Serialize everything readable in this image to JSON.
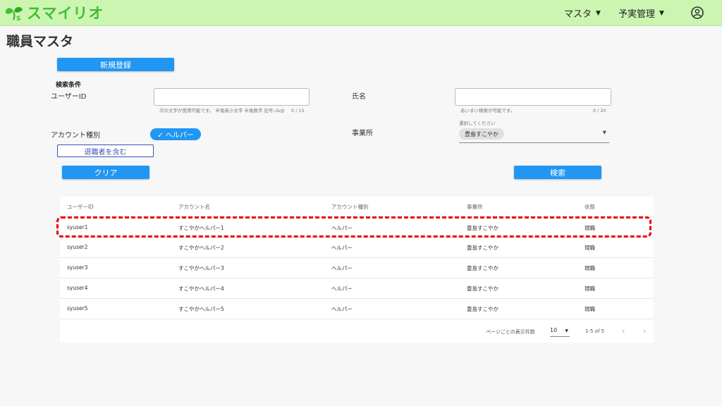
{
  "header": {
    "app_name": "スマイリオ",
    "menu_master": "マスタ",
    "menu_budget": "予実管理",
    "brand_color": "#ccf5b2",
    "account_icon": "account-circle-icon"
  },
  "page": {
    "title": "職員マスタ"
  },
  "actions": {
    "register_label": "新規登録",
    "clear_label": "クリア",
    "search_label": "検索"
  },
  "search": {
    "section_title": "検索条件",
    "user_id_label": "ユーザーID",
    "user_id_value": "",
    "user_id_hint": "次の文字が使用可能です。 半角英小文字 半角数字 記号-/&@",
    "user_id_counter": "0 / 15",
    "name_label": "氏名",
    "name_value": "",
    "name_hint": "あいまい検索が可能です。",
    "name_counter": "0 / 20",
    "account_type_label": "アカウント種別",
    "account_type_chip": "✓ ヘルパー",
    "office_label": "事業所",
    "office_placeholder": "選択してください",
    "office_selected": "豊島すこやか",
    "include_retired_label": "退職者を含む"
  },
  "table": {
    "headers": [
      "ユーザーID",
      "アカウント名",
      "アカウント種別",
      "事業所",
      "状態"
    ],
    "rows": [
      [
        "syuser1",
        "すこやかヘルパー1",
        "ヘルパー",
        "豊島すこやか",
        "現職"
      ],
      [
        "syuser2",
        "すこやかヘルパー2",
        "ヘルパー",
        "豊島すこやか",
        "現職"
      ],
      [
        "syuser3",
        "すこやかヘルパー3",
        "ヘルパー",
        "豊島すこやか",
        "現職"
      ],
      [
        "syuser4",
        "すこやかヘルパー4",
        "ヘルパー",
        "豊島すこやか",
        "現職"
      ],
      [
        "syuser5",
        "すこやかヘルパー5",
        "ヘルパー",
        "豊島すこやか",
        "現職"
      ]
    ],
    "highlight_color": "#e8000b"
  },
  "pagination": {
    "rows_per_page_label": "ページごとの表示件数",
    "rows_per_page_value": "10",
    "range_text": "1-5 of 5",
    "prev_icon": "chevron-left-icon",
    "next_icon": "chevron-right-icon"
  }
}
